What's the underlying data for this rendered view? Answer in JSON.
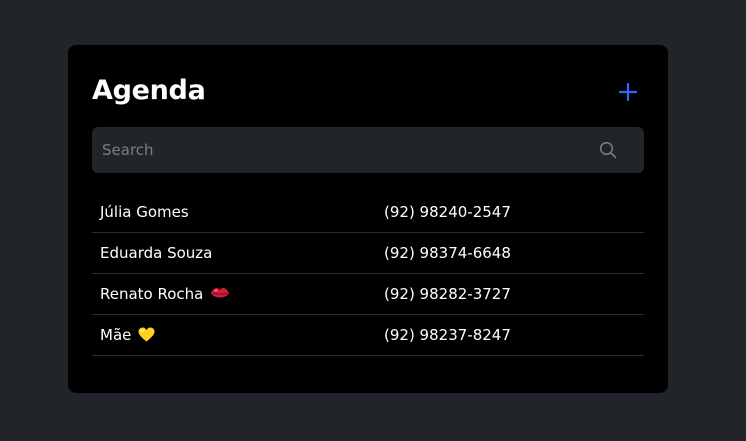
{
  "app": {
    "title": "Agenda",
    "add_button_label": "+"
  },
  "search": {
    "placeholder": "Search",
    "value": "",
    "icon": "search-icon"
  },
  "colors": {
    "page_background": "#212429",
    "card_background": "#000000",
    "search_background": "#212429",
    "accent": "#2f6bff",
    "text": "#ffffff",
    "divider": "#2a2d33"
  },
  "contacts": [
    {
      "name": "Júlia Gomes",
      "phone": "(92) 98240-2547",
      "emoji": null
    },
    {
      "name": "Eduarda Souza",
      "phone": "(92) 98374-6648",
      "emoji": null
    },
    {
      "name": "Renato Rocha",
      "phone": "(92) 98282-3727",
      "emoji": "lips-icon"
    },
    {
      "name": "Mãe",
      "phone": "(92) 98237-8247",
      "emoji": "yellow-heart-icon"
    }
  ]
}
